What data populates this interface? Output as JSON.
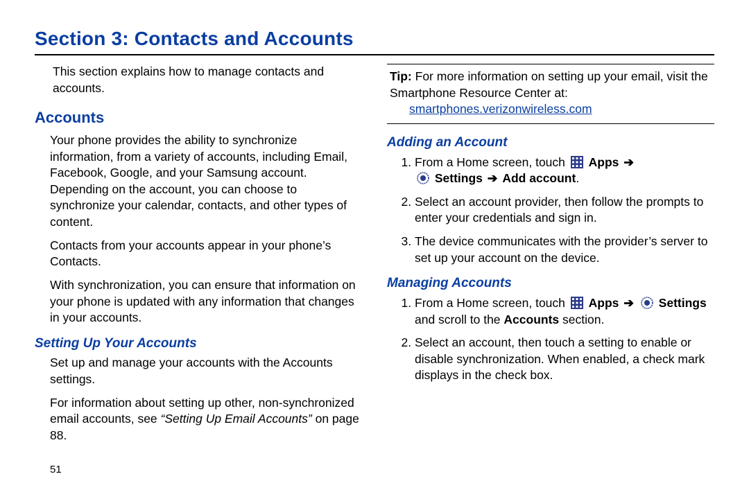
{
  "page_number": "51",
  "title": "Section 3: Contacts and Accounts",
  "intro": "This section explains how to manage contacts and accounts.",
  "left": {
    "h_accounts": "Accounts",
    "p1": "Your phone provides the ability to synchronize information, from a variety of accounts, including Email, Facebook, Google, and your Samsung account. Depending on the account, you can choose to synchronize your calendar, contacts, and other types of content.",
    "p2": "Contacts from your accounts appear in your phone’s Contacts.",
    "p3": "With synchronization, you can ensure that information on your phone is updated with any information that changes in your accounts.",
    "h_setup": "Setting Up Your Accounts",
    "p4": "Set up and manage your accounts with the Accounts settings.",
    "p5a": "For information about setting up other, non-synchronized email accounts, see ",
    "p5_xref": "“Setting Up Email Accounts”",
    "p5b": " on page 88."
  },
  "right": {
    "tip_label": "Tip:",
    "tip_body": " For more information on setting up your email, visit the Smartphone Resource Center at:",
    "tip_link": "smartphones.verizonwireless.com",
    "h_adding": "Adding an Account",
    "add_s1a": "From a Home screen, touch ",
    "apps_label": "Apps",
    "settings_label": "Settings",
    "add_account_label": "Add account",
    "add_s2": "Select an account provider, then follow the prompts to enter your credentials and sign in.",
    "add_s3": "The device communicates with the provider’s server to set up your account on the device.",
    "h_managing": "Managing Accounts",
    "mng_s1a": "From a Home screen, touch ",
    "mng_s1b": " and scroll to the ",
    "accounts_word": "Accounts",
    "mng_s1c": " section.",
    "mng_s2": "Select an account, then touch a setting to enable or disable synchronization. When enabled, a check mark displays in the check box."
  },
  "glyphs": {
    "arrow": "➔"
  }
}
